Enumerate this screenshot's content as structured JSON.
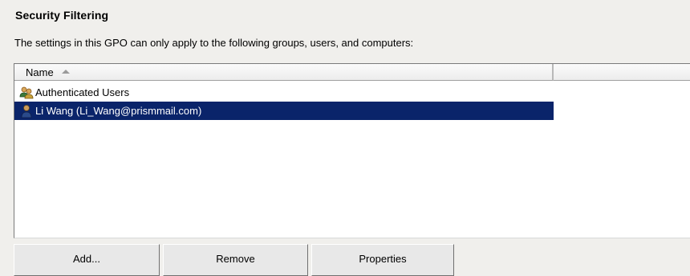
{
  "section": {
    "title": "Security Filtering",
    "description": "The settings in this GPO can only apply to the following groups, users, and computers:"
  },
  "list": {
    "columns": [
      "Name",
      ""
    ],
    "sort_indicator": "sort-ascending-icon",
    "rows": [
      {
        "icon": "group-users-icon",
        "label": "Authenticated Users",
        "selected": false
      },
      {
        "icon": "user-icon",
        "label": "Li Wang (Li_Wang@prismmail.com)",
        "selected": true
      }
    ]
  },
  "buttons": {
    "add": "Add...",
    "remove": "Remove",
    "properties": "Properties"
  },
  "colors": {
    "selection_bg": "#0a246a",
    "selection_fg": "#ffffff",
    "window_bg": "#f0efec"
  }
}
